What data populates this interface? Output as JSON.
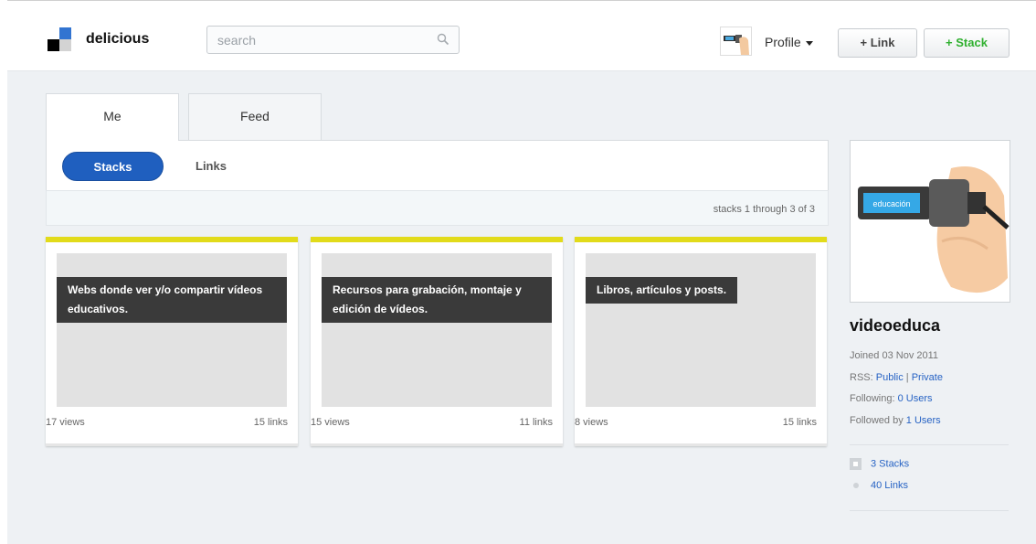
{
  "header": {
    "brand": "delicious",
    "search_placeholder": "search",
    "profile_label": "Profile",
    "add_link_label": "+ Link",
    "add_stack_label": "+ Stack",
    "colors": {
      "logo_blue": "#3274d1",
      "stack_green": "#2fb02f"
    }
  },
  "tabs": [
    {
      "label": "Me",
      "active": true
    },
    {
      "label": "Feed",
      "active": false
    }
  ],
  "subtabs": {
    "stacks": "Stacks",
    "links": "Links"
  },
  "count_text": "stacks 1 through 3 of 3",
  "stacks": [
    {
      "title": "Webs donde ver y/o compartir vídeos educativos.",
      "views": "17 views",
      "links": "15 links"
    },
    {
      "title": "Recursos para grabación, montaje y edición de vídeos.",
      "views": "15 views",
      "links": "11 links"
    },
    {
      "title": "Libros, artículos y posts.",
      "views": "8 views",
      "links": "15 links"
    }
  ],
  "user": {
    "avatar_label": "educación",
    "name": "videoeduca",
    "joined": "Joined 03 Nov 2011",
    "rss_label": "RSS:",
    "rss_public": "Public",
    "rss_sep": "|",
    "rss_private": "Private",
    "following_label": "Following:",
    "following_value": "0 Users",
    "followed_label": "Followed by",
    "followed_value": "1 Users",
    "stacks_count": "3 Stacks",
    "links_count": "40 Links"
  },
  "accent": {
    "stack_pill": "#1f5fbf",
    "card_top": "#e2db1a"
  }
}
